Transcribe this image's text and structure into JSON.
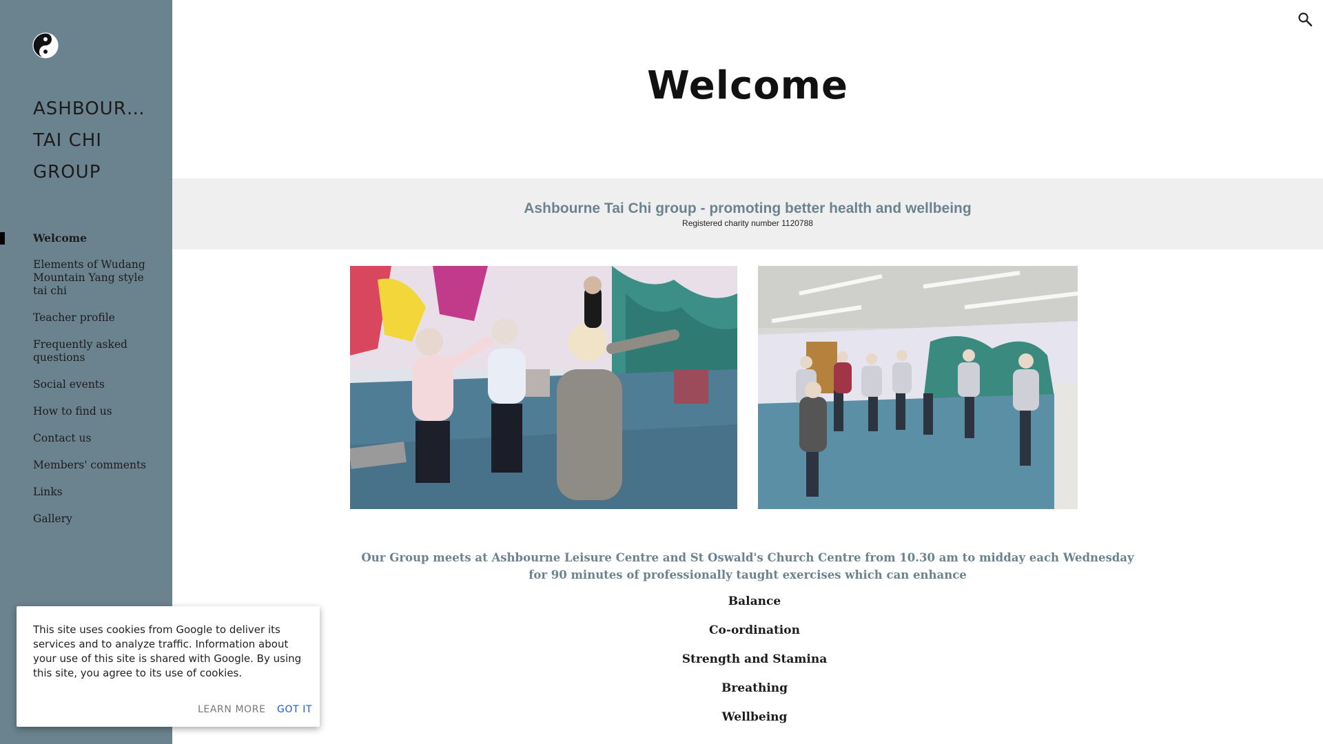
{
  "site": {
    "title_lines": [
      "ASHBOURNE",
      "TAI CHI",
      "GROUP"
    ]
  },
  "nav": {
    "items": [
      {
        "label": "Welcome",
        "active": true
      },
      {
        "label": "Elements of Wudang Mountain Yang style tai chi"
      },
      {
        "label": "Teacher profile"
      },
      {
        "label": "Frequently asked questions"
      },
      {
        "label": "Social events"
      },
      {
        "label": "How to find us"
      },
      {
        "label": "Contact us"
      },
      {
        "label": "Members' comments"
      },
      {
        "label": "Links"
      },
      {
        "label": "Gallery"
      }
    ]
  },
  "header": {
    "search_icon": "search-icon"
  },
  "page": {
    "title": "Welcome",
    "banner_heading": "Ashbourne Tai Chi group - promoting better health and wellbeing",
    "banner_sub": "Registered charity number 1120788",
    "intro": "Our Group meets at Ashbourne Leisure Centre and St Oswald's Church Centre from 10.30 am to midday each Wednesday for 90 minutes of professionally  taught exercises  which can enhance",
    "benefits": [
      "Balance",
      "Co-ordination",
      "Strength and Stamina",
      "Breathing",
      "Wellbeing"
    ]
  },
  "cookie": {
    "text": "This site uses cookies from Google to deliver its services and to analyze traffic. Information about your use of this site is shared with Google. By using this site, you agree to its use of cookies.",
    "learn_more": "LEARN MORE",
    "got_it": "GOT IT"
  },
  "colors": {
    "sidebar_bg": "#6b838f",
    "accent_text": "#6b838f",
    "banner_bg": "#efefef",
    "link_blue": "#1a5ccf"
  }
}
